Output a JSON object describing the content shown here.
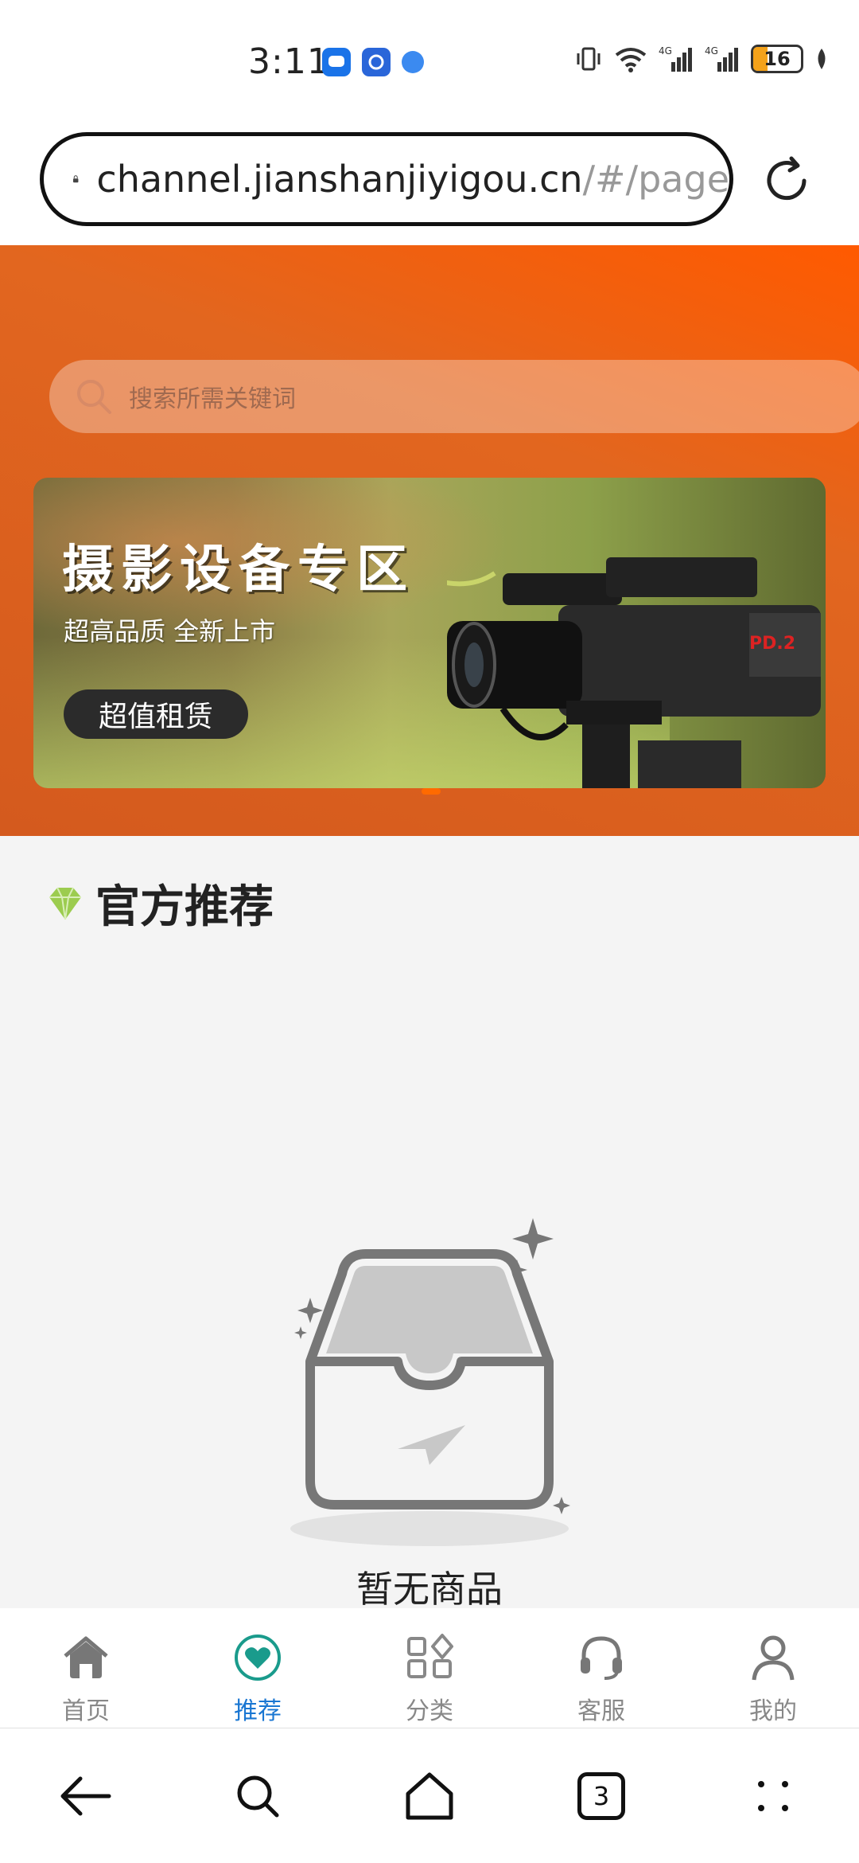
{
  "status_bar": {
    "time": "3:11",
    "battery": "16"
  },
  "browser": {
    "url_host": "channel.jianshanjiyigou.cn",
    "url_path": "/#/page",
    "tab_count": "3"
  },
  "search": {
    "placeholder": "搜索所需关键词"
  },
  "banner": {
    "title": "摄影设备专区",
    "subtitle": "超高品质 全新上市",
    "button_label": "超值租赁"
  },
  "section": {
    "title": "官方推荐"
  },
  "empty_state": {
    "text": "暂无商品"
  },
  "tabbar": {
    "items": [
      {
        "label": "首页",
        "icon": "home-icon"
      },
      {
        "label": "推荐",
        "icon": "heart-icon"
      },
      {
        "label": "分类",
        "icon": "category-icon"
      },
      {
        "label": "客服",
        "icon": "headset-icon"
      },
      {
        "label": "我的",
        "icon": "user-icon"
      }
    ],
    "active_index": 1
  },
  "colors": {
    "accent": "#ff5a00",
    "active_tab": "#1976d2",
    "active_icon": "#1a9b8c"
  }
}
